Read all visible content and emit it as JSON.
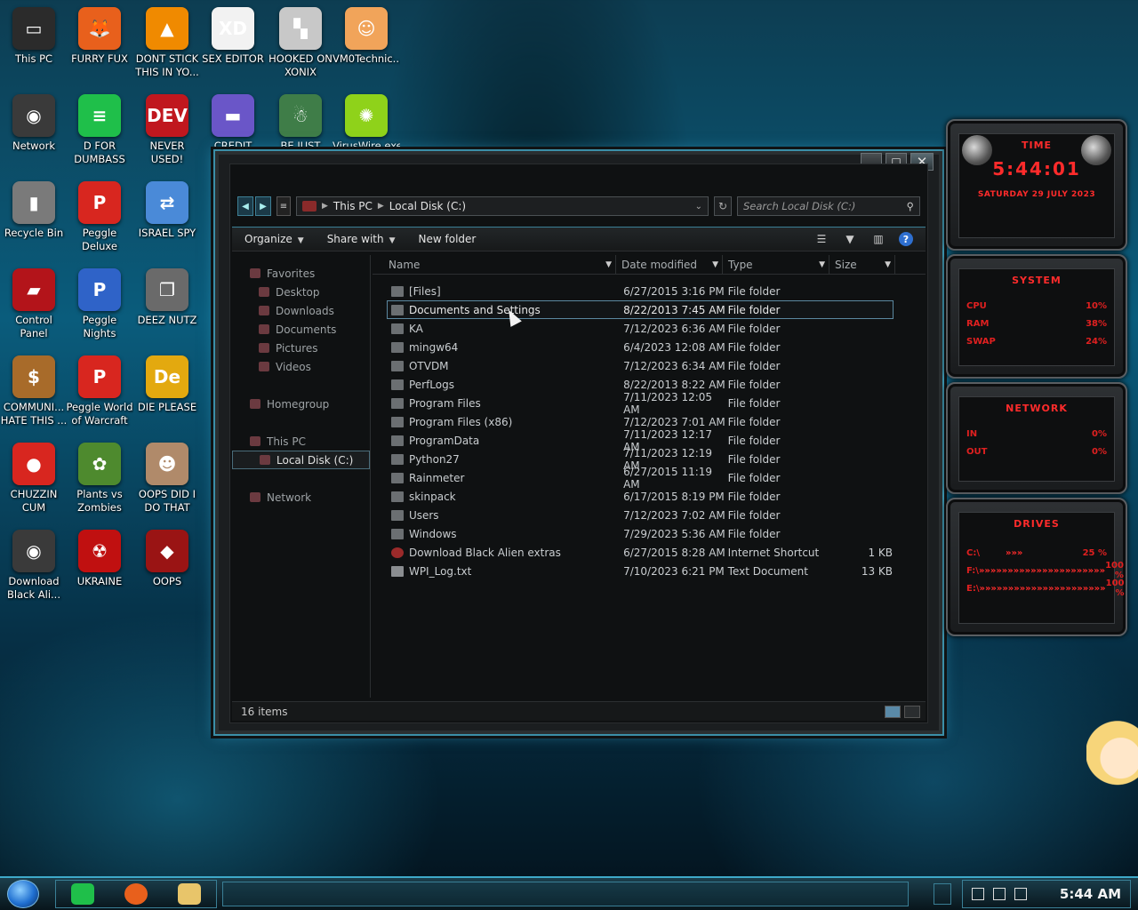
{
  "desktop": {
    "icons": [
      {
        "label": "This PC",
        "color": "#2b2b2b",
        "glyph": "▭"
      },
      {
        "label": "FURRY FUX",
        "color": "#e8601c",
        "glyph": "🦊"
      },
      {
        "label": "DONT STICK THIS IN YO...",
        "color": "#f08a00",
        "glyph": "▲"
      },
      {
        "label": "SEX EDITOR",
        "color": "#f2f2f2",
        "glyph": "XD"
      },
      {
        "label": "HOOKED ON XONIX",
        "color": "#c8c8c8",
        "glyph": "▚"
      },
      {
        "label": "VM0Technic...",
        "color": "#f1a45a",
        "glyph": "☺"
      },
      {
        "label": "Network",
        "color": "#3a3a3a",
        "glyph": "◉"
      },
      {
        "label": "D FOR DUMBASS",
        "color": "#1fbf4a",
        "glyph": "≡"
      },
      {
        "label": "NEVER USED!",
        "color": "#c0171e",
        "glyph": "DEV"
      },
      {
        "label": "CREDIT CARD...",
        "color": "#6a56c8",
        "glyph": "▬"
      },
      {
        "label": "BE JUST LIKE...",
        "color": "#3f7d48",
        "glyph": "☃"
      },
      {
        "label": "VirusWire.exe",
        "color": "#8fd21a",
        "glyph": "✺"
      },
      {
        "label": "Recycle Bin",
        "color": "#7a7a7a",
        "glyph": "▮"
      },
      {
        "label": "Peggle Deluxe",
        "color": "#d8261f",
        "glyph": "P"
      },
      {
        "label": "ISRAEL SPY",
        "color": "#4a8ad8",
        "glyph": "⇄"
      },
      {
        "label": "Control Panel",
        "color": "#b3141a",
        "glyph": "▰"
      },
      {
        "label": "Peggle Nights Deluxe",
        "color": "#2f63c8",
        "glyph": "P"
      },
      {
        "label": "DEEZ NUTZ",
        "color": "#6a6a6a",
        "glyph": "❐"
      },
      {
        "label": "COMMUNI... HATE THIS ...",
        "color": "#a86b2a",
        "glyph": "$"
      },
      {
        "label": "Peggle World of Warcraft ...",
        "color": "#d8261f",
        "glyph": "P"
      },
      {
        "label": "DIE PLEASE",
        "color": "#e3a90f",
        "glyph": "De"
      },
      {
        "label": "CHUZZIN CUM",
        "color": "#d8261f",
        "glyph": "●"
      },
      {
        "label": "Plants vs Zombies",
        "color": "#4e8a2e",
        "glyph": "✿"
      },
      {
        "label": "OOPS DID I DO THAT",
        "color": "#b08a6a",
        "glyph": "☻"
      },
      {
        "label": "Download Black Ali...",
        "color": "#3a3a3a",
        "glyph": "◉"
      },
      {
        "label": "UKRAINE",
        "color": "#c01010",
        "glyph": "☢"
      },
      {
        "label": "OOPS",
        "color": "#9a1414",
        "glyph": "◆"
      }
    ]
  },
  "explorer": {
    "address": {
      "root": "This PC",
      "current": "Local Disk (C:)"
    },
    "search_placeholder": "Search Local Disk (C:)",
    "toolbar": {
      "organize": "Organize",
      "share_with": "Share with",
      "new_folder": "New folder"
    },
    "nav": {
      "favorites": "Favorites",
      "desktop": "Desktop",
      "downloads": "Downloads",
      "documents": "Documents",
      "pictures": "Pictures",
      "videos": "Videos",
      "homegroup": "Homegroup",
      "this_pc": "This PC",
      "local_disk": "Local Disk (C:)",
      "network": "Network"
    },
    "columns": {
      "name": "Name",
      "date": "Date modified",
      "type": "Type",
      "size": "Size"
    },
    "files": [
      {
        "name": "[Files]",
        "date": "6/27/2015 3:16 PM",
        "type": "File folder",
        "size": ""
      },
      {
        "name": "Documents and Settings",
        "date": "8/22/2013 7:45 AM",
        "type": "File folder",
        "size": ""
      },
      {
        "name": "KA",
        "date": "7/12/2023 6:36 AM",
        "type": "File folder",
        "size": ""
      },
      {
        "name": "mingw64",
        "date": "6/4/2023 12:08 AM",
        "type": "File folder",
        "size": ""
      },
      {
        "name": "OTVDM",
        "date": "7/12/2023 6:34 AM",
        "type": "File folder",
        "size": ""
      },
      {
        "name": "PerfLogs",
        "date": "8/22/2013 8:22 AM",
        "type": "File folder",
        "size": ""
      },
      {
        "name": "Program Files",
        "date": "7/11/2023 12:05 AM",
        "type": "File folder",
        "size": ""
      },
      {
        "name": "Program Files (x86)",
        "date": "7/12/2023 7:01 AM",
        "type": "File folder",
        "size": ""
      },
      {
        "name": "ProgramData",
        "date": "7/11/2023 12:17 AM",
        "type": "File folder",
        "size": ""
      },
      {
        "name": "Python27",
        "date": "7/11/2023 12:19 AM",
        "type": "File folder",
        "size": ""
      },
      {
        "name": "Rainmeter",
        "date": "6/27/2015 11:19 AM",
        "type": "File folder",
        "size": ""
      },
      {
        "name": "skinpack",
        "date": "6/17/2015 8:19 PM",
        "type": "File folder",
        "size": ""
      },
      {
        "name": "Users",
        "date": "7/12/2023 7:02 AM",
        "type": "File folder",
        "size": ""
      },
      {
        "name": "Windows",
        "date": "7/29/2023 5:36 AM",
        "type": "File folder",
        "size": ""
      },
      {
        "name": "Download Black Alien extras",
        "date": "6/27/2015 8:28 AM",
        "type": "Internet Shortcut",
        "size": "1 KB"
      },
      {
        "name": "WPI_Log.txt",
        "date": "7/10/2023 6:21 PM",
        "type": "Text Document",
        "size": "13 KB"
      }
    ],
    "status": "16 items"
  },
  "gadgets": {
    "time": {
      "title": "TIME",
      "value": "5:44:01",
      "date": "SATURDAY 29 JULY 2023"
    },
    "system": {
      "title": "SYSTEM",
      "rows": [
        {
          "label": "CPU",
          "pct": "10%"
        },
        {
          "label": "RAM",
          "pct": "38%"
        },
        {
          "label": "SWAP",
          "pct": "24%"
        }
      ]
    },
    "network": {
      "title": "NETWORK",
      "rows": [
        {
          "label": "IN",
          "pct": "0%"
        },
        {
          "label": "OUT",
          "pct": "0%"
        }
      ]
    },
    "drives": {
      "title": "DRIVES",
      "rows": [
        {
          "label": "C:\\",
          "bar": "»»»",
          "pct": "25 %"
        },
        {
          "label": "F:\\",
          "bar": "»»»»»»»»»»»»»»»»»»»»»»",
          "pct": "100 %"
        },
        {
          "label": "E:\\",
          "bar": "»»»»»»»»»»»»»»»»»»»»»»",
          "pct": "100 %"
        }
      ]
    }
  },
  "taskbar": {
    "clock": "5:44 AM"
  }
}
